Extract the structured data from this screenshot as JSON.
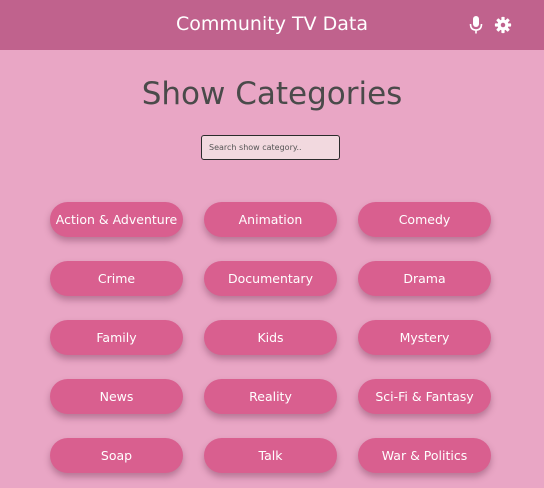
{
  "header": {
    "title": "Community TV Data",
    "icons": [
      "mic-icon",
      "gear-icon"
    ]
  },
  "page": {
    "title": "Show Categories"
  },
  "search": {
    "placeholder": "Search show category..",
    "value": ""
  },
  "categories": [
    "Action & Adventure",
    "Animation",
    "Comedy",
    "Crime",
    "Documentary",
    "Drama",
    "Family",
    "Kids",
    "Mystery",
    "News",
    "Reality",
    "Sci-Fi & Fantasy",
    "Soap",
    "Talk",
    "War & Politics"
  ],
  "colors": {
    "background": "#e9a6c5",
    "header": "#c0628d",
    "button": "#d95f8f",
    "button_text": "#ffffff",
    "title_text": "#4a4a4a"
  }
}
